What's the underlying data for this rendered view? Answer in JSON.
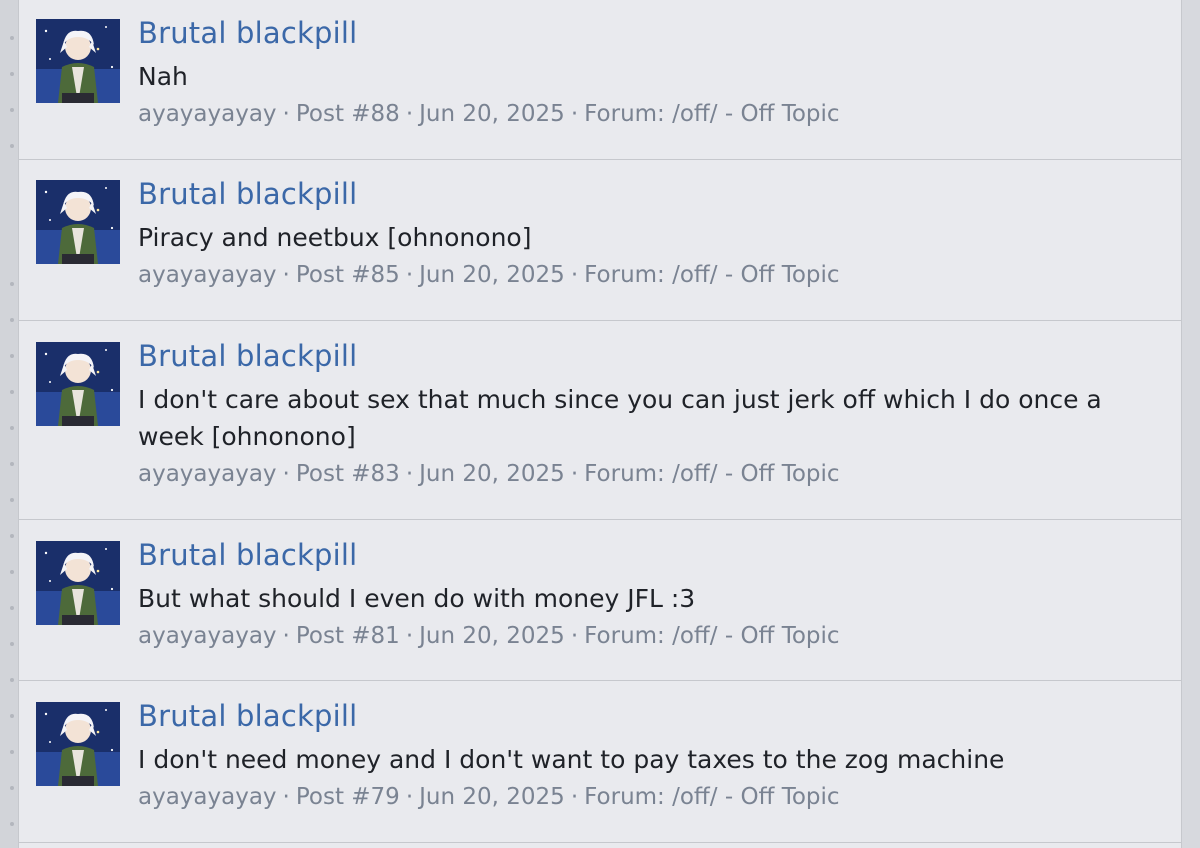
{
  "results": [
    {
      "title": "Brutal blackpill",
      "snippet": "Nah",
      "author": "ayayayayay",
      "post": "Post #88",
      "date": "Jun 20, 2025",
      "forum": "Forum: /off/ - Off Topic"
    },
    {
      "title": "Brutal blackpill",
      "snippet": "Piracy and neetbux [ohnonono]",
      "author": "ayayayayay",
      "post": "Post #85",
      "date": "Jun 20, 2025",
      "forum": "Forum: /off/ - Off Topic"
    },
    {
      "title": "Brutal blackpill",
      "snippet": "I don't care about sex that much since you can just jerk off which I do once a week [ohnonono]",
      "author": "ayayayayay",
      "post": "Post #83",
      "date": "Jun 20, 2025",
      "forum": "Forum: /off/ - Off Topic"
    },
    {
      "title": "Brutal blackpill",
      "snippet": "But what should I even do with money JFL :3",
      "author": "ayayayayay",
      "post": "Post #81",
      "date": "Jun 20, 2025",
      "forum": "Forum: /off/ - Off Topic"
    },
    {
      "title": "Brutal blackpill",
      "snippet": "I don't need money and I don't want to pay taxes to the zog machine",
      "author": "ayayayayay",
      "post": "Post #79",
      "date": "Jun 20, 2025",
      "forum": "Forum: /off/ - Off Topic"
    }
  ],
  "separator": "·",
  "colors": {
    "title_link": "#3b68a8",
    "meta": "#7a8392",
    "background": "#e9eaee"
  }
}
